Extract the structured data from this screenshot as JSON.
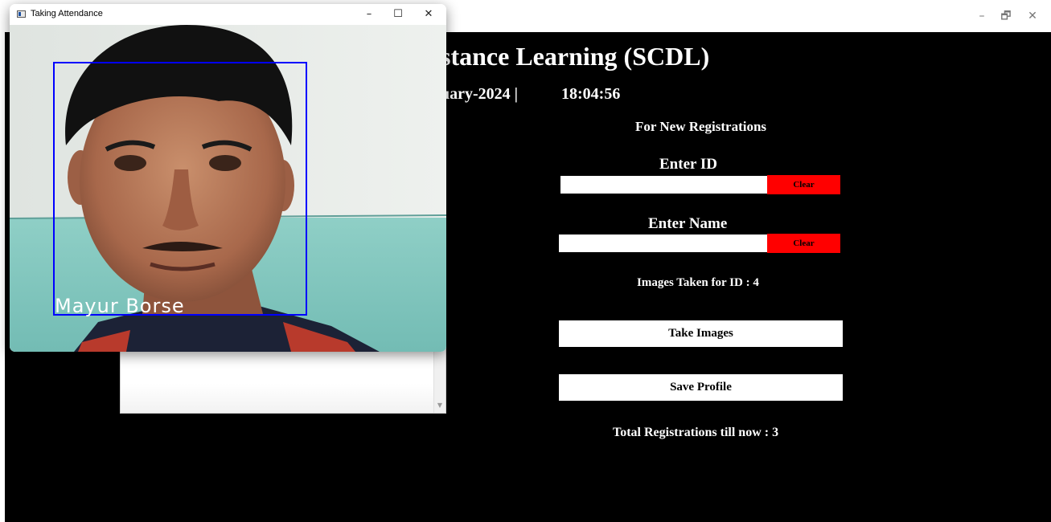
{
  "main_window": {
    "controls": {
      "minimize": "–",
      "restore": "🗗",
      "close": "✕"
    },
    "app_title": "stance Learning (SCDL)",
    "date": "uary-2024  |",
    "time": "18:04:56",
    "registration": {
      "heading": "For New Registrations",
      "id_label": "Enter ID",
      "id_value": "",
      "clear_id_label": "Clear",
      "name_label": "Enter Name",
      "name_value": "",
      "clear_name_label": "Clear",
      "images_taken_text": "Images Taken for ID : 4",
      "take_images_label": "Take Images",
      "save_profile_label": "Save Profile",
      "total_registrations_text": "Total Registrations till now  : 3"
    },
    "table_scroll": {
      "up": "▲",
      "down": "▼"
    }
  },
  "camera_window": {
    "title": "Taking Attendance",
    "controls": {
      "minimize": "–",
      "maximize": "☐",
      "close": "✕"
    },
    "detected_name": "Mayur  Borse",
    "box_color": "#0000ff"
  }
}
